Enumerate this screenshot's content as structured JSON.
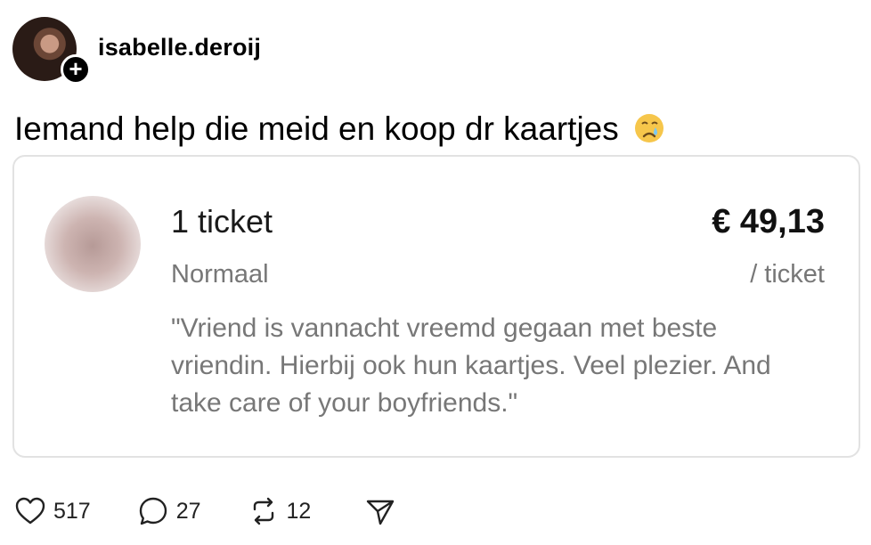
{
  "post": {
    "username": "isabelle.deroij",
    "follow_symbol": "+",
    "text": "Iemand help die meid en koop dr kaartjes",
    "emoji": "crying-face-emoji"
  },
  "ticket_card": {
    "count": "1 ticket",
    "price": "€ 49,13",
    "type": "Normaal",
    "per_unit": "/ ticket",
    "message": "\"Vriend is vannacht vreemd gegaan met beste vriendin. Hierbij ook hun kaartjes. Veel plezier. And take care of your boyfriends.\""
  },
  "actions": {
    "likes": "517",
    "comments": "27",
    "reposts": "12"
  },
  "colors": {
    "text": "#000000",
    "muted": "#777777",
    "border": "#e2e2e2"
  }
}
